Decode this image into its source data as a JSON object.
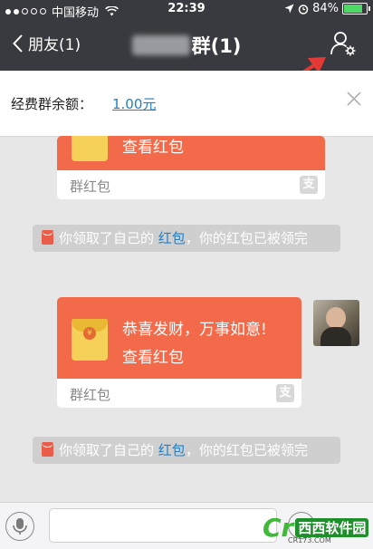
{
  "status_bar": {
    "carrier": "中国移动",
    "time": "22:39",
    "battery": "84%",
    "battery_level": 0.84
  },
  "nav": {
    "back_label": "朋友(1)",
    "title": "群(1)"
  },
  "banner": {
    "label": "经费群余额：",
    "value": "1.00元"
  },
  "messages": [
    {
      "type": "red_packet",
      "open_label": "查看红包",
      "packet_type": "群红包"
    },
    {
      "type": "notice",
      "prefix": "你领取了自己的",
      "link": "红包",
      "suffix": "，你的红包已被领完"
    },
    {
      "type": "red_packet",
      "wish": "恭喜发财，万事如意!",
      "open_label": "查看红包",
      "packet_type": "群红包",
      "coin_symbol": "¥"
    },
    {
      "type": "notice",
      "prefix": "你领取了自己的",
      "link": "红包",
      "suffix": "，你的红包已被领完"
    }
  ],
  "watermark": {
    "brand": "西西软件园",
    "site": "CR173.COM",
    "logo_letters": "Cr"
  },
  "colors": {
    "nav_bg": "#393a3f",
    "packet_orange": "#f26a4a",
    "link_blue": "#1f7fc8",
    "arrow_red": "#e53935"
  },
  "icons": {
    "back": "chevron-left-icon",
    "group_info": "group-settings-icon",
    "close": "close-icon",
    "voice": "microphone-icon",
    "emoji": "emoji-icon",
    "packet_logo": "payment-logo-icon"
  }
}
